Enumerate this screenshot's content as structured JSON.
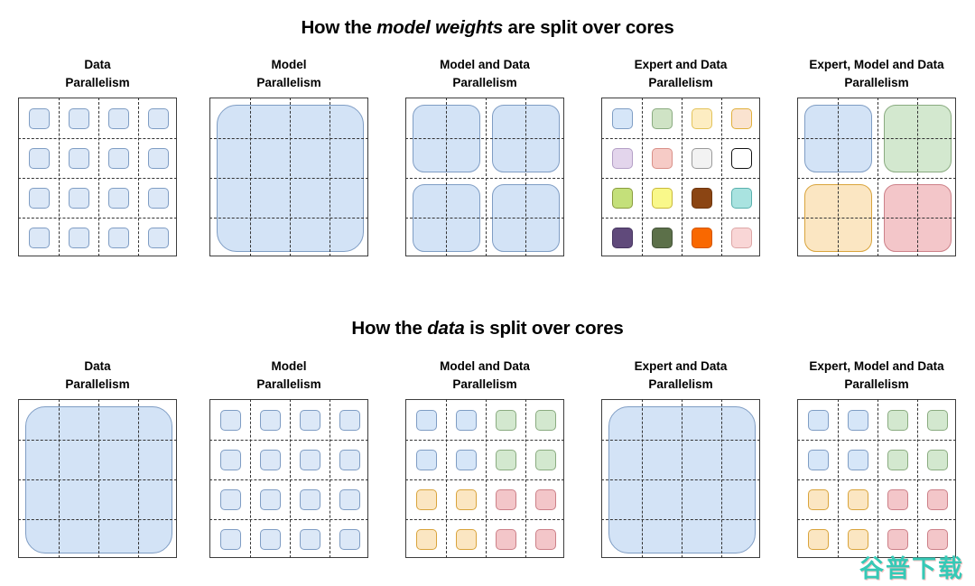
{
  "titles": {
    "weights_prefix": "How the ",
    "weights_em": "model weights",
    "weights_suffix": " are split over cores",
    "data_prefix": "How the ",
    "data_em": "data",
    "data_suffix": " is split over cores"
  },
  "watermark": "谷普下载",
  "colors": {
    "panel_border": "#3d3d3d",
    "gridline": "#333333",
    "blue_fill": "#d6e6f8",
    "blue_border": "#7f9dc4",
    "green_fill": "#d3e8cf",
    "green_border": "#8aab80",
    "amber_fill": "#fbe6c2",
    "amber_border": "#d9a43c",
    "red_fill": "#f3c6c9",
    "red_border": "#cc8088",
    "watermark": "#35c9b6"
  },
  "grid": {
    "rows": 4,
    "cols": 4
  },
  "sections": [
    {
      "id": "weights",
      "panels": [
        {
          "header": "Data\nParallelism",
          "layout": "cells-4x4",
          "cells": [
            {
              "fill": "#dce8f7",
              "border": "#7f9dc4"
            },
            {
              "fill": "#dce8f7",
              "border": "#7f9dc4"
            },
            {
              "fill": "#dce8f7",
              "border": "#7f9dc4"
            },
            {
              "fill": "#dce8f7",
              "border": "#7f9dc4"
            },
            {
              "fill": "#dce8f7",
              "border": "#7f9dc4"
            },
            {
              "fill": "#dce8f7",
              "border": "#7f9dc4"
            },
            {
              "fill": "#dce8f7",
              "border": "#7f9dc4"
            },
            {
              "fill": "#dce8f7",
              "border": "#7f9dc4"
            },
            {
              "fill": "#dce8f7",
              "border": "#7f9dc4"
            },
            {
              "fill": "#dce8f7",
              "border": "#7f9dc4"
            },
            {
              "fill": "#dce8f7",
              "border": "#7f9dc4"
            },
            {
              "fill": "#dce8f7",
              "border": "#7f9dc4"
            },
            {
              "fill": "#dce8f7",
              "border": "#7f9dc4"
            },
            {
              "fill": "#dce8f7",
              "border": "#7f9dc4"
            },
            {
              "fill": "#dce8f7",
              "border": "#7f9dc4"
            },
            {
              "fill": "#dce8f7",
              "border": "#7f9dc4"
            }
          ]
        },
        {
          "header": "Model\nParallelism",
          "layout": "blocks",
          "blocks": [
            {
              "row": 0,
              "col": 0,
              "rowspan": 4,
              "colspan": 4,
              "fill": "#d3e3f6",
              "border": "#7f9dc4"
            }
          ]
        },
        {
          "header": "Model and Data\nParallelism",
          "layout": "blocks",
          "blocks": [
            {
              "row": 0,
              "col": 0,
              "rowspan": 2,
              "colspan": 2,
              "fill": "#d3e3f6",
              "border": "#7f9dc4"
            },
            {
              "row": 0,
              "col": 2,
              "rowspan": 2,
              "colspan": 2,
              "fill": "#d3e3f6",
              "border": "#7f9dc4"
            },
            {
              "row": 2,
              "col": 0,
              "rowspan": 2,
              "colspan": 2,
              "fill": "#d3e3f6",
              "border": "#7f9dc4"
            },
            {
              "row": 2,
              "col": 2,
              "rowspan": 2,
              "colspan": 2,
              "fill": "#d3e3f6",
              "border": "#7f9dc4"
            }
          ]
        },
        {
          "header": "Expert and Data\nParallelism",
          "layout": "cells-4x4",
          "cells": [
            {
              "fill": "#d6e6f8",
              "border": "#7f9dc4"
            },
            {
              "fill": "#cfe3c5",
              "border": "#8aab80"
            },
            {
              "fill": "#fdedc2",
              "border": "#e3c35a"
            },
            {
              "fill": "#fae3d0",
              "border": "#e0b03c"
            },
            {
              "fill": "#e3d5ec",
              "border": "#b49fc6"
            },
            {
              "fill": "#f6cbc6",
              "border": "#d99088"
            },
            {
              "fill": "#f2f2f2",
              "border": "#9a9a9a"
            },
            {
              "fill": "#ffffff",
              "border": "#111111"
            },
            {
              "fill": "#c4e07a",
              "border": "#8a9c3e"
            },
            {
              "fill": "#f9f88a",
              "border": "#c9b93a"
            },
            {
              "fill": "#8b4513",
              "border": "#6e360f"
            },
            {
              "fill": "#a9e3e0",
              "border": "#59b0ad"
            },
            {
              "fill": "#604a7b",
              "border": "#463560"
            },
            {
              "fill": "#5c7049",
              "border": "#45543a"
            },
            {
              "fill": "#f96800",
              "border": "#d35600"
            },
            {
              "fill": "#f9d6d6",
              "border": "#dda6a6"
            }
          ]
        },
        {
          "header": "Expert, Model and Data\nParallelism",
          "layout": "blocks",
          "blocks": [
            {
              "row": 0,
              "col": 0,
              "rowspan": 2,
              "colspan": 2,
              "fill": "#d3e3f6",
              "border": "#7f9dc4"
            },
            {
              "row": 0,
              "col": 2,
              "rowspan": 2,
              "colspan": 2,
              "fill": "#d3e8cf",
              "border": "#8aab80"
            },
            {
              "row": 2,
              "col": 0,
              "rowspan": 2,
              "colspan": 2,
              "fill": "#fbe6c2",
              "border": "#d9a43c"
            },
            {
              "row": 2,
              "col": 2,
              "rowspan": 2,
              "colspan": 2,
              "fill": "#f3c6c9",
              "border": "#cc8088"
            }
          ]
        }
      ]
    },
    {
      "id": "data",
      "panels": [
        {
          "header": "Data\nParallelism",
          "layout": "blocks",
          "blocks": [
            {
              "row": 0,
              "col": 0,
              "rowspan": 4,
              "colspan": 4,
              "fill": "#d3e3f6",
              "border": "#7f9dc4"
            }
          ]
        },
        {
          "header": "Model\nParallelism",
          "layout": "cells-4x4",
          "cells": [
            {
              "fill": "#dce8f7",
              "border": "#7f9dc4"
            },
            {
              "fill": "#dce8f7",
              "border": "#7f9dc4"
            },
            {
              "fill": "#dce8f7",
              "border": "#7f9dc4"
            },
            {
              "fill": "#dce8f7",
              "border": "#7f9dc4"
            },
            {
              "fill": "#dce8f7",
              "border": "#7f9dc4"
            },
            {
              "fill": "#dce8f7",
              "border": "#7f9dc4"
            },
            {
              "fill": "#dce8f7",
              "border": "#7f9dc4"
            },
            {
              "fill": "#dce8f7",
              "border": "#7f9dc4"
            },
            {
              "fill": "#dce8f7",
              "border": "#7f9dc4"
            },
            {
              "fill": "#dce8f7",
              "border": "#7f9dc4"
            },
            {
              "fill": "#dce8f7",
              "border": "#7f9dc4"
            },
            {
              "fill": "#dce8f7",
              "border": "#7f9dc4"
            },
            {
              "fill": "#dce8f7",
              "border": "#7f9dc4"
            },
            {
              "fill": "#dce8f7",
              "border": "#7f9dc4"
            },
            {
              "fill": "#dce8f7",
              "border": "#7f9dc4"
            },
            {
              "fill": "#dce8f7",
              "border": "#7f9dc4"
            }
          ]
        },
        {
          "header": "Model and Data\nParallelism",
          "layout": "cells-4x4",
          "cells": [
            {
              "fill": "#d6e6f8",
              "border": "#7f9dc4"
            },
            {
              "fill": "#d6e6f8",
              "border": "#7f9dc4"
            },
            {
              "fill": "#d3e8cf",
              "border": "#8aab80"
            },
            {
              "fill": "#d3e8cf",
              "border": "#8aab80"
            },
            {
              "fill": "#d6e6f8",
              "border": "#7f9dc4"
            },
            {
              "fill": "#d6e6f8",
              "border": "#7f9dc4"
            },
            {
              "fill": "#d3e8cf",
              "border": "#8aab80"
            },
            {
              "fill": "#d3e8cf",
              "border": "#8aab80"
            },
            {
              "fill": "#fbe6c2",
              "border": "#d9a43c"
            },
            {
              "fill": "#fbe6c2",
              "border": "#d9a43c"
            },
            {
              "fill": "#f3c6c9",
              "border": "#cc8088"
            },
            {
              "fill": "#f3c6c9",
              "border": "#cc8088"
            },
            {
              "fill": "#fbe6c2",
              "border": "#d9a43c"
            },
            {
              "fill": "#fbe6c2",
              "border": "#d9a43c"
            },
            {
              "fill": "#f3c6c9",
              "border": "#cc8088"
            },
            {
              "fill": "#f3c6c9",
              "border": "#cc8088"
            }
          ]
        },
        {
          "header": "Expert and Data\nParallelism",
          "layout": "blocks",
          "blocks": [
            {
              "row": 0,
              "col": 0,
              "rowspan": 4,
              "colspan": 4,
              "fill": "#d3e3f6",
              "border": "#7f9dc4"
            }
          ]
        },
        {
          "header": "Expert, Model and Data\nParallelism",
          "layout": "cells-4x4",
          "cells": [
            {
              "fill": "#d6e6f8",
              "border": "#7f9dc4"
            },
            {
              "fill": "#d6e6f8",
              "border": "#7f9dc4"
            },
            {
              "fill": "#d3e8cf",
              "border": "#8aab80"
            },
            {
              "fill": "#d3e8cf",
              "border": "#8aab80"
            },
            {
              "fill": "#d6e6f8",
              "border": "#7f9dc4"
            },
            {
              "fill": "#d6e6f8",
              "border": "#7f9dc4"
            },
            {
              "fill": "#d3e8cf",
              "border": "#8aab80"
            },
            {
              "fill": "#d3e8cf",
              "border": "#8aab80"
            },
            {
              "fill": "#fbe6c2",
              "border": "#d9a43c"
            },
            {
              "fill": "#fbe6c2",
              "border": "#d9a43c"
            },
            {
              "fill": "#f3c6c9",
              "border": "#cc8088"
            },
            {
              "fill": "#f3c6c9",
              "border": "#cc8088"
            },
            {
              "fill": "#fbe6c2",
              "border": "#d9a43c"
            },
            {
              "fill": "#fbe6c2",
              "border": "#d9a43c"
            },
            {
              "fill": "#f3c6c9",
              "border": "#cc8088"
            },
            {
              "fill": "#f3c6c9",
              "border": "#cc8088"
            }
          ]
        }
      ]
    }
  ]
}
